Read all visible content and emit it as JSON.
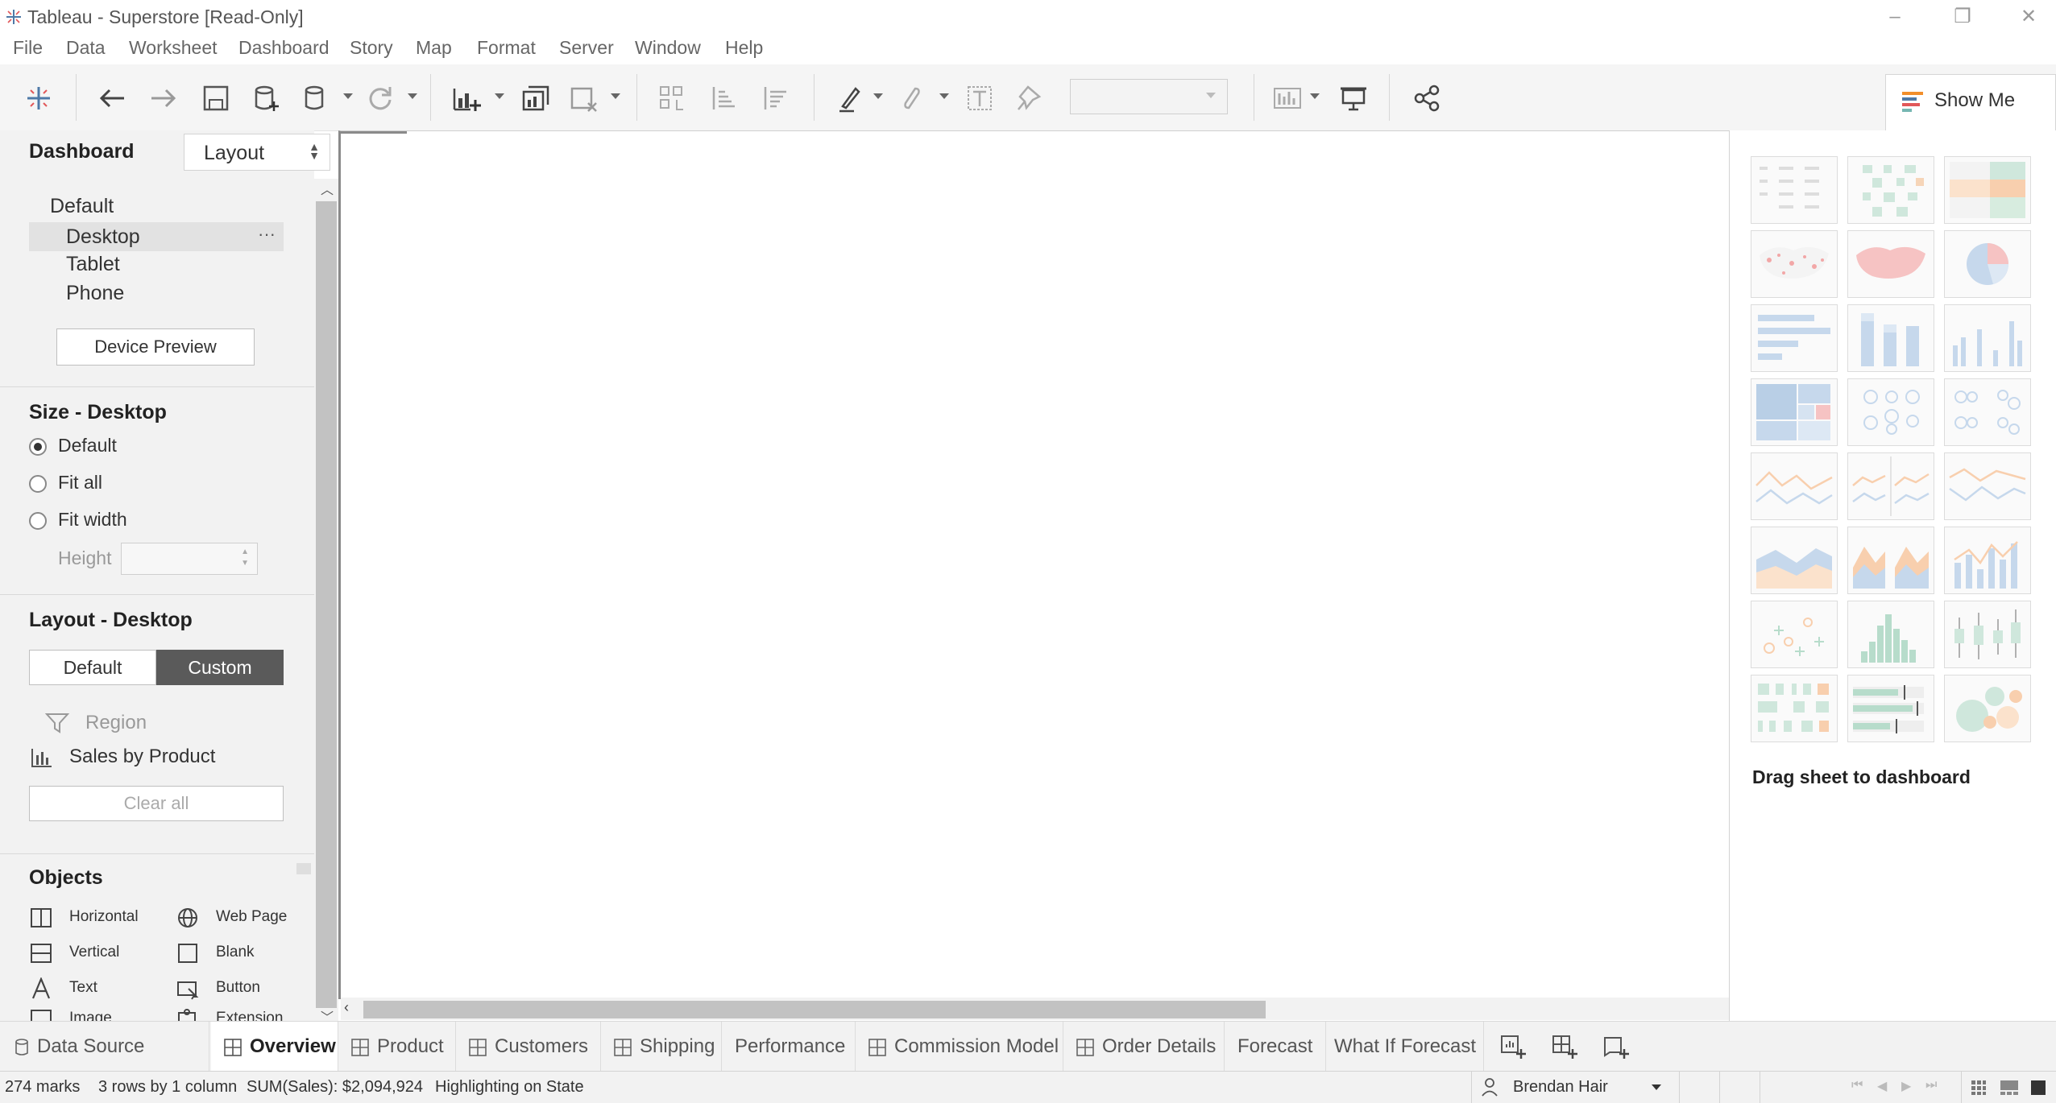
{
  "window": {
    "title": "Tableau - Superstore [Read-Only]",
    "minimize_icon": "minimize-icon",
    "restore_icon": "restore-icon",
    "close_icon": "close-icon"
  },
  "menu": [
    "File",
    "Data",
    "Worksheet",
    "Dashboard",
    "Story",
    "Map",
    "Format",
    "Server",
    "Window",
    "Help"
  ],
  "left_panel": {
    "tabs": {
      "dashboard": "Dashboard",
      "layout": "Layout"
    },
    "devices": [
      "Default",
      "Desktop",
      "Tablet",
      "Phone"
    ],
    "device_more": "···",
    "device_preview_button": "Device Preview",
    "size_section": {
      "title": "Size - Desktop",
      "options": [
        "Default",
        "Fit all",
        "Fit width"
      ],
      "selected": "Default",
      "height_label": "Height",
      "height_value": ""
    },
    "layout_section": {
      "title": "Layout - Desktop",
      "toggle": [
        "Default",
        "Custom"
      ],
      "selected": "Custom",
      "items": [
        "Region",
        "Sales by Product"
      ],
      "clear_all": "Clear all"
    },
    "objects_section": {
      "title": "Objects",
      "items": [
        "Horizontal",
        "Web Page",
        "Vertical",
        "Blank",
        "Text",
        "Button",
        "Image",
        "Extension"
      ]
    }
  },
  "show_me": {
    "button_label": "Show Me",
    "hint": "Drag sheet to dashboard"
  },
  "sheet_tabs": {
    "data_source": "Data Source",
    "tabs": [
      "Overview",
      "Product",
      "Customers",
      "Shipping",
      "Performance",
      "Commission Model",
      "Order Details",
      "Forecast",
      "What If Forecast"
    ],
    "active": "Overview"
  },
  "status": {
    "marks": "274 marks",
    "rows_cols": "3 rows by 1 column",
    "sum": "SUM(Sales): $2,094,924",
    "highlighting": "Highlighting on State",
    "user": "Brendan Hair"
  },
  "colors": {
    "accent_dark": "#5a5a5a",
    "panel_bg": "#f2f2f2",
    "selected_row": "#e2e2e2"
  }
}
